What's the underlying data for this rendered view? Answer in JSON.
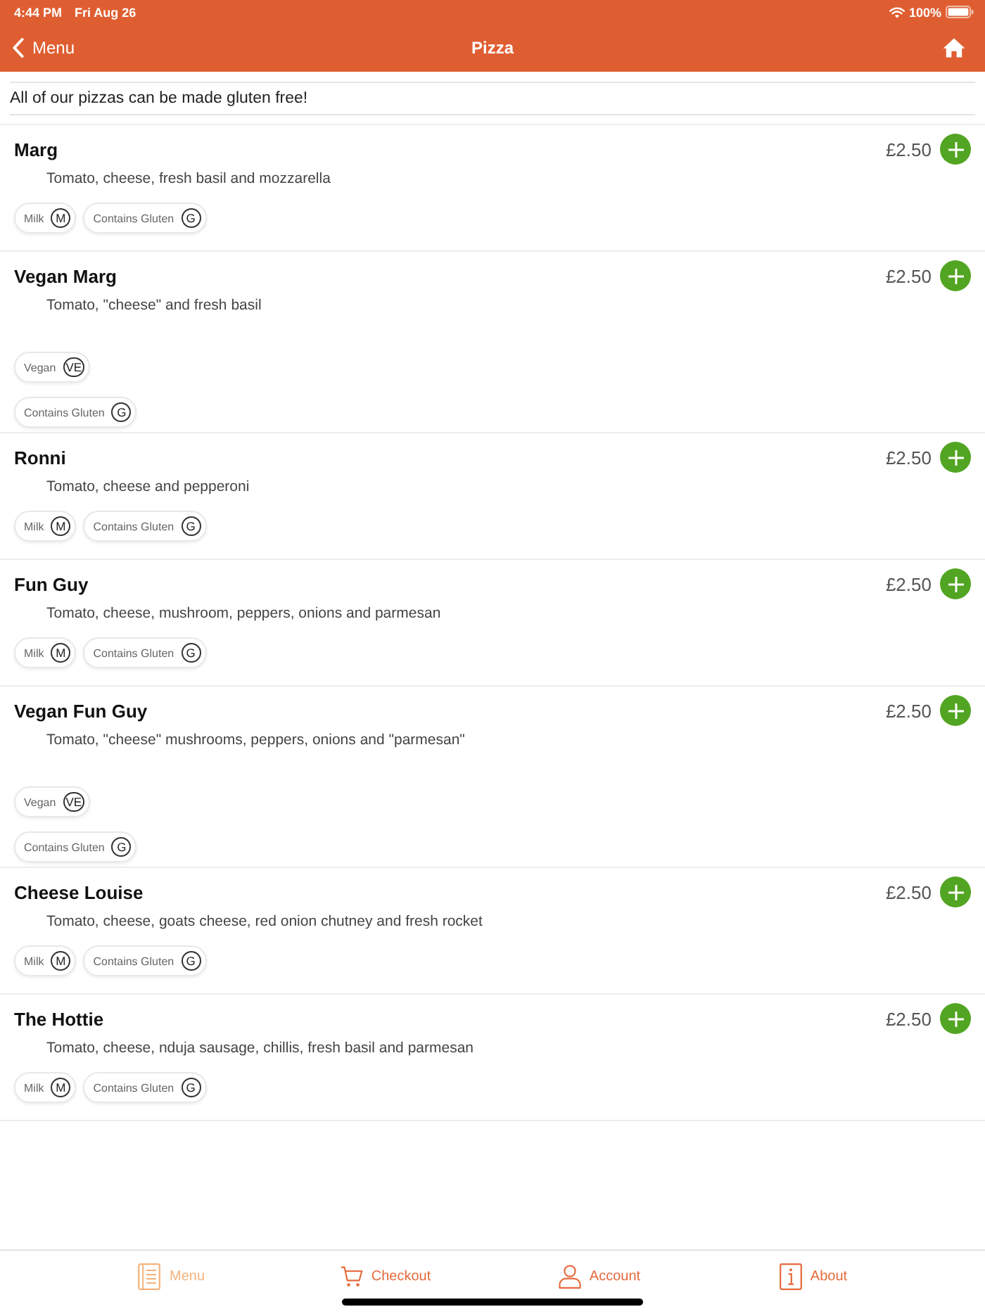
{
  "status_bar": {
    "time": "4:44 PM",
    "date": "Fri Aug 26",
    "battery": "100%"
  },
  "nav_bar": {
    "back": "Menu",
    "title": "Pizza"
  },
  "notice": "All of our pizzas can be made gluten free!",
  "items": [
    {
      "name": "Marg",
      "price": "£2.50",
      "description": "Tomato, cheese, fresh basil and mozzarella",
      "tag_rows": [
        [
          {
            "label": "Milk",
            "code": "M"
          },
          {
            "label": "Contains Gluten",
            "code": "G"
          }
        ]
      ]
    },
    {
      "name": "Vegan Marg",
      "price": "£2.50",
      "description": "Tomato, \"cheese\" and fresh basil",
      "tag_rows": [
        [
          {
            "label": "Vegan",
            "code": "VE"
          }
        ],
        [
          {
            "label": "Contains Gluten",
            "code": "G"
          }
        ]
      ]
    },
    {
      "name": "Ronni",
      "price": "£2.50",
      "description": "Tomato, cheese and pepperoni",
      "tag_rows": [
        [
          {
            "label": "Milk",
            "code": "M"
          },
          {
            "label": "Contains Gluten",
            "code": "G"
          }
        ]
      ]
    },
    {
      "name": "Fun Guy",
      "price": "£2.50",
      "description": "Tomato, cheese, mushroom, peppers, onions and parmesan",
      "tag_rows": [
        [
          {
            "label": "Milk",
            "code": "M"
          },
          {
            "label": "Contains Gluten",
            "code": "G"
          }
        ]
      ]
    },
    {
      "name": "Vegan Fun Guy",
      "price": "£2.50",
      "description": "Tomato, \"cheese\" mushrooms, peppers, onions and \"parmesan\"",
      "tag_rows": [
        [
          {
            "label": "Vegan",
            "code": "VE"
          }
        ],
        [
          {
            "label": "Contains Gluten",
            "code": "G"
          }
        ]
      ]
    },
    {
      "name": "Cheese Louise",
      "price": "£2.50",
      "description": "Tomato, cheese, goats cheese, red onion chutney and fresh rocket",
      "tag_rows": [
        [
          {
            "label": "Milk",
            "code": "M"
          },
          {
            "label": "Contains Gluten",
            "code": "G"
          }
        ]
      ]
    },
    {
      "name": "The Hottie",
      "price": "£2.50",
      "description": "Tomato, cheese, nduja sausage, chillis, fresh basil and parmesan",
      "tag_rows": [
        [
          {
            "label": "Milk",
            "code": "M"
          },
          {
            "label": "Contains Gluten",
            "code": "G"
          }
        ]
      ]
    }
  ],
  "tab_bar": [
    {
      "label": "Menu",
      "selected": true
    },
    {
      "label": "Checkout",
      "selected": false
    },
    {
      "label": "Account",
      "selected": false
    },
    {
      "label": "About",
      "selected": false
    }
  ]
}
